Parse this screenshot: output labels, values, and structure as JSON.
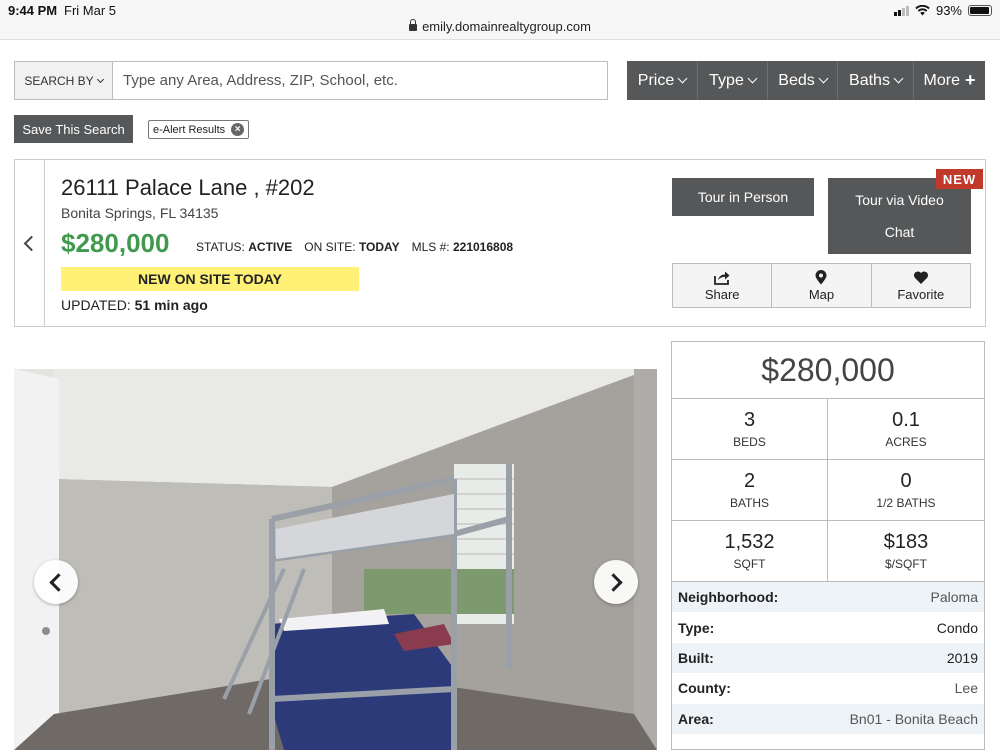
{
  "status_bar": {
    "time": "9:44 PM",
    "date": "Fri Mar 5",
    "battery": "93%",
    "battery_level": 0.93
  },
  "browser": {
    "url": "emily.domainrealtygroup.com"
  },
  "search": {
    "search_by_label": "SEARCH BY",
    "placeholder": "Type any Area, Address, ZIP, School, etc.",
    "value": ""
  },
  "filters": [
    {
      "label": "Price",
      "icon": "chevron-down-icon"
    },
    {
      "label": "Type",
      "icon": "chevron-down-icon"
    },
    {
      "label": "Beds",
      "icon": "chevron-down-icon"
    },
    {
      "label": "Baths",
      "icon": "chevron-down-icon"
    },
    {
      "label": "More",
      "icon": "plus-icon"
    }
  ],
  "save_search_label": "Save This Search",
  "alert_chip": {
    "label": "e-Alert Results",
    "icon": "close-circle-icon"
  },
  "listing": {
    "address": "26111 Palace Lane , #202",
    "city_line": "Bonita Springs, FL 34135",
    "price": "$280,000",
    "status_label": "STATUS:",
    "status_value": "ACTIVE",
    "onsite_label": "ON SITE:",
    "onsite_value": "TODAY",
    "mls_label": "MLS #:",
    "mls_value": "221016808",
    "banner": "NEW ON SITE TODAY",
    "banner_color": "#fff176",
    "updated_label": "UPDATED:",
    "updated_value": "51 min ago",
    "price_color": "#3f9a4e"
  },
  "tour": {
    "in_person": "Tour in Person",
    "video_line1": "Tour via Video",
    "video_line2": "Chat",
    "new_tag": "NEW",
    "new_tag_color": "#c0392b"
  },
  "actions": [
    {
      "label": "Share",
      "icon": "share-icon"
    },
    {
      "label": "Map",
      "icon": "map-pin-icon"
    },
    {
      "label": "Favorite",
      "icon": "heart-icon"
    }
  ],
  "panel": {
    "price": "$280,000",
    "stats": [
      {
        "value": "3",
        "label": "BEDS"
      },
      {
        "value": "0.1",
        "label": "ACRES"
      },
      {
        "value": "2",
        "label": "BATHS"
      },
      {
        "value": "0",
        "label": "1/2 BATHS"
      },
      {
        "value": "1,532",
        "label": "SQFT"
      },
      {
        "value": "$183",
        "label": "$/SQFT"
      }
    ],
    "details": [
      {
        "key": "Neighborhood:",
        "value": "Paloma"
      },
      {
        "key": "Type:",
        "value": "Condo"
      },
      {
        "key": "Built:",
        "value": "2019"
      },
      {
        "key": "County:",
        "value": "Lee"
      },
      {
        "key": "Area:",
        "value": "Bn01 - Bonita Beach"
      }
    ]
  },
  "colors": {
    "dark_button": "#555759",
    "accent_green": "#3f9a4e"
  }
}
